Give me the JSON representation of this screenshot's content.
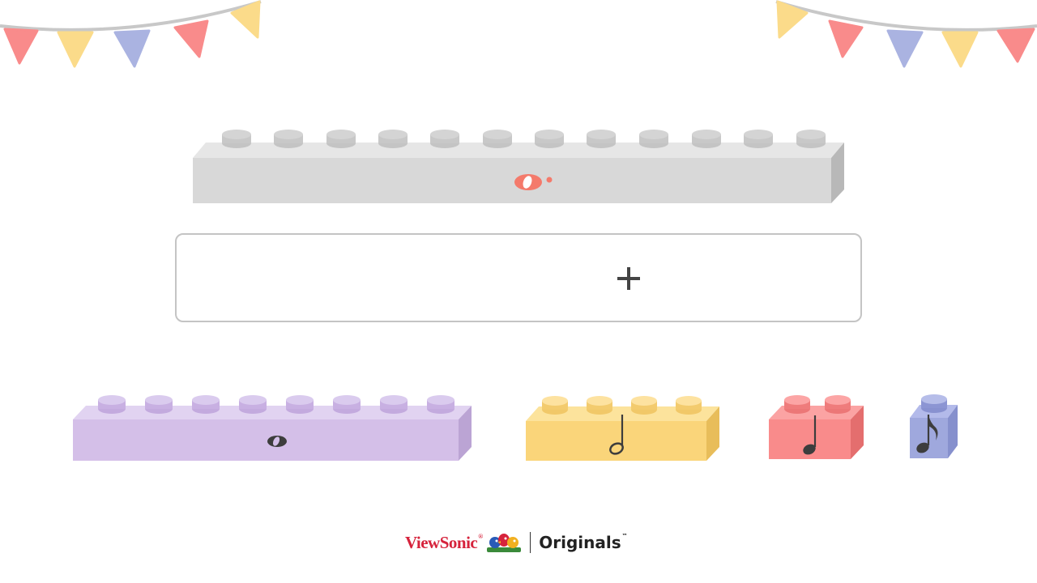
{
  "colors": {
    "pennant_red": "#f98b8b",
    "pennant_yellow": "#fbdb8a",
    "pennant_blue": "#aab3e1",
    "string": "#c8c8c8",
    "target_brick": "#d8d8d8",
    "target_symbol": "#f47a6b",
    "purple": "#d4bfe8",
    "yellow": "#fad57a",
    "red": "#f98b8b",
    "blue": "#9fa8dd",
    "note_ink": "#3d3d3d",
    "brand_red": "#d6233c"
  },
  "target_brick": {
    "symbol": "dotted-whole-note",
    "studs": 12
  },
  "answer_area": {
    "icon": "plus-icon"
  },
  "bricks": [
    {
      "color": "purple",
      "symbol": "whole-note",
      "studs": 8
    },
    {
      "color": "yellow",
      "symbol": "half-note",
      "studs": 4
    },
    {
      "color": "red",
      "symbol": "quarter-note",
      "studs": 2
    },
    {
      "color": "blue",
      "symbol": "eighth-note",
      "studs": 1
    }
  ],
  "footer": {
    "brand": "ViewSonic",
    "registered": "®",
    "originals": "Originals",
    "trademark": "™",
    "mascot_icon": "birds-mascot-icon"
  }
}
